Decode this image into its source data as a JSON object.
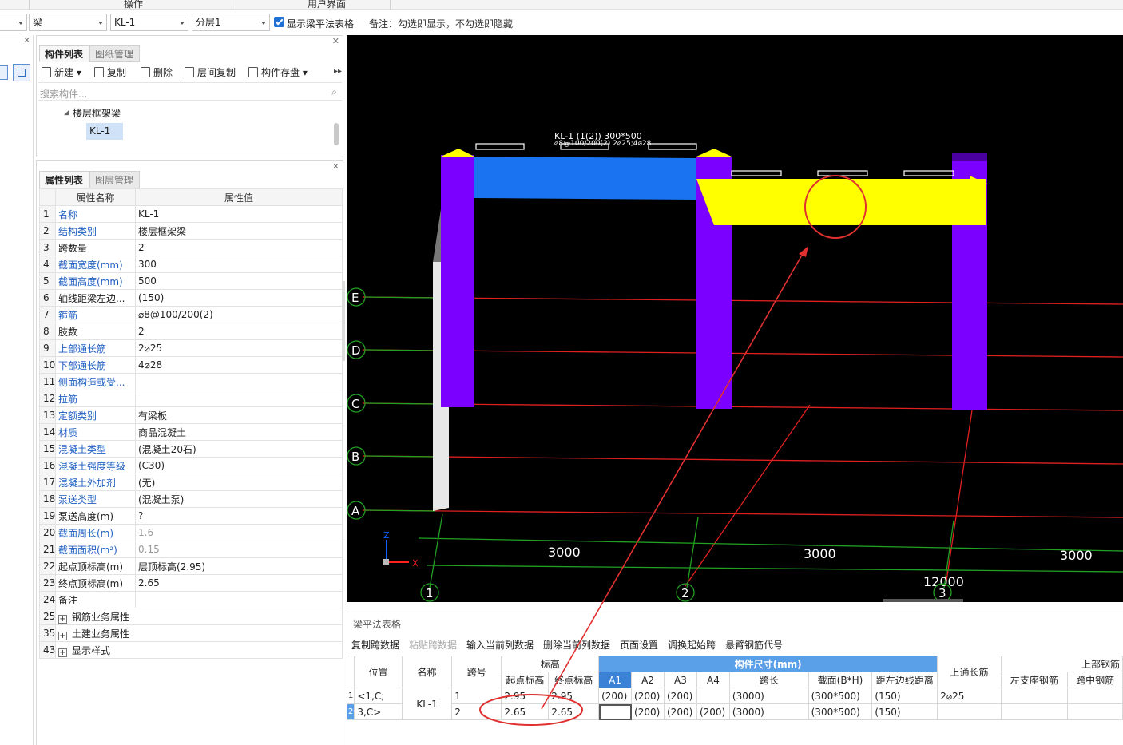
{
  "top_band": {
    "ops_label": "操作",
    "ui_label": "用户界面"
  },
  "toolbar": {
    "type_select": "梁",
    "component_select": "KL-1",
    "layer_select": "分层1",
    "show_table_label": "显示梁平法表格",
    "note": "备注：勾选即显示，不勾选即隐藏"
  },
  "component_panel": {
    "tabs": [
      "构件列表",
      "图纸管理"
    ],
    "tools": {
      "new": "新建",
      "copy": "复制",
      "delete": "删除",
      "floor_copy": "层间复制",
      "save": "构件存盘"
    },
    "search_placeholder": "搜索构件...",
    "tree": {
      "group": "楼层框架梁",
      "item": "KL-1"
    }
  },
  "property_panel": {
    "tabs": [
      "属性列表",
      "图层管理"
    ],
    "headers": {
      "name": "属性名称",
      "value": "属性值"
    },
    "rows": [
      {
        "n": "1",
        "k": "名称",
        "v": "KL-1"
      },
      {
        "n": "2",
        "k": "结构类别",
        "v": "楼层框架梁"
      },
      {
        "n": "3",
        "k": "跨数量",
        "v": "2"
      },
      {
        "n": "4",
        "k": "截面宽度(mm)",
        "v": "300"
      },
      {
        "n": "5",
        "k": "截面高度(mm)",
        "v": "500"
      },
      {
        "n": "6",
        "k": "轴线距梁左边...",
        "v": "(150)"
      },
      {
        "n": "7",
        "k": "箍筋",
        "v": "⌀8@100/200(2)"
      },
      {
        "n": "8",
        "k": "肢数",
        "v": "2"
      },
      {
        "n": "9",
        "k": "上部通长筋",
        "v": "2⌀25"
      },
      {
        "n": "10",
        "k": "下部通长筋",
        "v": "4⌀28"
      },
      {
        "n": "11",
        "k": "侧面构造或受...",
        "v": ""
      },
      {
        "n": "12",
        "k": "拉筋",
        "v": ""
      },
      {
        "n": "13",
        "k": "定额类别",
        "v": "有梁板"
      },
      {
        "n": "14",
        "k": "材质",
        "v": "商品混凝土"
      },
      {
        "n": "15",
        "k": "混凝土类型",
        "v": "(混凝土20石)"
      },
      {
        "n": "16",
        "k": "混凝土强度等级",
        "v": "(C30)"
      },
      {
        "n": "17",
        "k": "混凝土外加剂",
        "v": "(无)"
      },
      {
        "n": "18",
        "k": "泵送类型",
        "v": "(混凝土泵)"
      },
      {
        "n": "19",
        "k": "泵送高度(m)",
        "v": "?"
      },
      {
        "n": "20",
        "k": "截面周长(m)",
        "v": "1.6"
      },
      {
        "n": "21",
        "k": "截面面积(m²)",
        "v": "0.15"
      },
      {
        "n": "22",
        "k": "起点顶标高(m)",
        "v": "层顶标高(2.95)"
      },
      {
        "n": "23",
        "k": "终点顶标高(m)",
        "v": "2.65"
      },
      {
        "n": "24",
        "k": "备注",
        "v": ""
      },
      {
        "n": "25",
        "k": "钢筋业务属性",
        "v": ""
      },
      {
        "n": "35",
        "k": "土建业务属性",
        "v": ""
      },
      {
        "n": "43",
        "k": "显示样式",
        "v": ""
      }
    ]
  },
  "viewport": {
    "axis_rows": [
      "E",
      "D",
      "C",
      "B",
      "A"
    ],
    "axis_cols": [
      "1",
      "2",
      "3"
    ],
    "dims": [
      "3000",
      "3000",
      "3000"
    ],
    "total_dim": "12000",
    "beam_label_1": "KL-1 (1(2)) 300*500",
    "beam_label_2": "⌀8@100/200(2) 2⌀25;4⌀28",
    "coord_z": "Z",
    "coord_x": "X"
  },
  "beam_table": {
    "title": "梁平法表格",
    "actions": [
      "复制跨数据",
      "粘贴跨数据",
      "输入当前列数据",
      "删除当前列数据",
      "页面设置",
      "调换起始跨",
      "悬臂钢筋代号"
    ],
    "headers": {
      "pos": "位置",
      "name": "名称",
      "span": "跨号",
      "elev": "标高",
      "elev_start": "起点标高",
      "elev_end": "终点标高",
      "dims": "构件尺寸(mm)",
      "a1": "A1",
      "a2": "A2",
      "a3": "A3",
      "a4": "A4",
      "span_len": "跨长",
      "section": "截面(B*H)",
      "edge": "距左边线距离",
      "top_cont": "上通长筋",
      "top_bar": "上部钢筋",
      "left_sup": "左支座钢筋",
      "mid": "跨中钢筋"
    },
    "pos_value_1": "<1,C;",
    "pos_value_2": "3,C>",
    "name_value": "KL-1",
    "rows": [
      {
        "idx": "1",
        "span": "1",
        "es": "2.95",
        "ee": "2.95",
        "a1": "(200)",
        "a2": "(200)",
        "a3": "(200)",
        "a4": "",
        "len": "(3000)",
        "sec": "(300*500)",
        "edge": "(150)",
        "top": "2⌀25"
      },
      {
        "idx": "2",
        "span": "2",
        "es": "2.65",
        "ee": "2.65",
        "a1": "",
        "a2": "(200)",
        "a3": "(200)",
        "a4": "(200)",
        "len": "(3000)",
        "sec": "(300*500)",
        "edge": "(150)",
        "top": ""
      }
    ]
  },
  "colors": {
    "accent": "#1e6fd6",
    "beam_blue": "#1a73f0",
    "beam_yellow": "#ffff00",
    "column": "#7b00ff",
    "annotation": "#e03030"
  }
}
